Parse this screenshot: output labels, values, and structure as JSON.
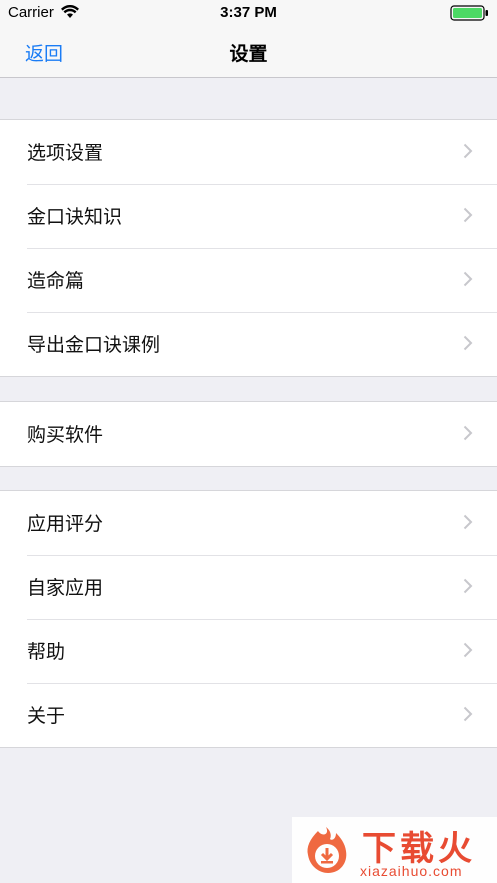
{
  "status_bar": {
    "carrier": "Carrier",
    "time": "3:37 PM",
    "battery_color": "#4cd964"
  },
  "nav": {
    "back_label": "返回",
    "title": "设置",
    "accent_color": "#1a7cf5"
  },
  "groups": [
    {
      "items": [
        {
          "label": "选项设置"
        },
        {
          "label": "金口诀知识"
        },
        {
          "label": "造命篇"
        },
        {
          "label": "导出金口诀课例"
        }
      ]
    },
    {
      "items": [
        {
          "label": "购买软件"
        }
      ]
    },
    {
      "items": [
        {
          "label": "应用评分"
        },
        {
          "label": "自家应用"
        },
        {
          "label": "帮助"
        },
        {
          "label": "关于"
        }
      ]
    }
  ],
  "watermark": {
    "text": "下载火",
    "subtext": "xiazaihuo.com",
    "color": "#e8452b"
  }
}
